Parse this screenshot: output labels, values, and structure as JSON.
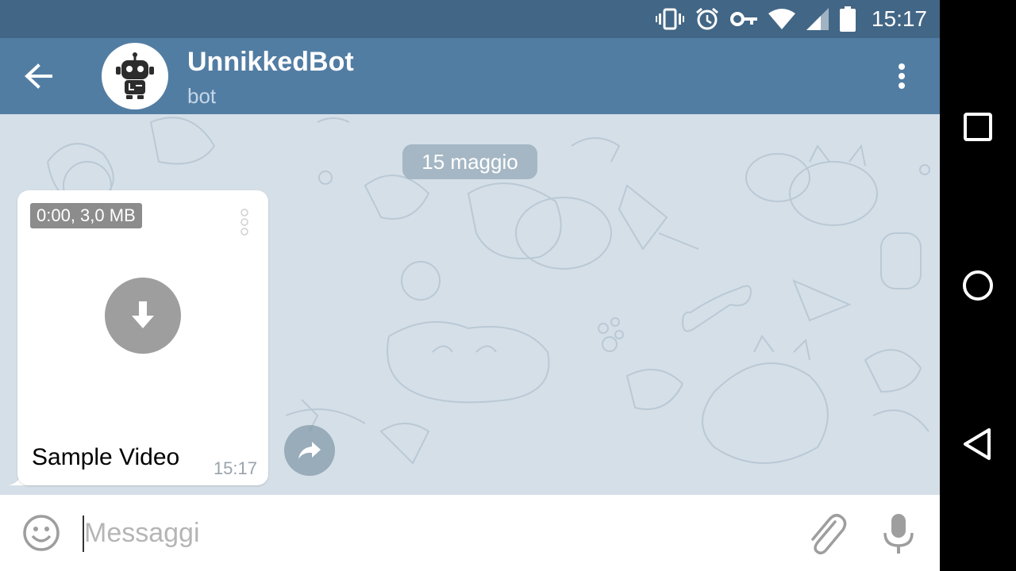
{
  "status_bar": {
    "time": "15:17",
    "icons": [
      "vibrate-icon",
      "alarm-icon",
      "vpn-key-icon",
      "wifi-icon",
      "cell-signal-icon",
      "battery-icon"
    ]
  },
  "header": {
    "title": "UnnikkedBot",
    "subtitle": "bot",
    "back_icon": "arrow-back-icon",
    "menu_icon": "more-vert-icon",
    "colors": {
      "status_bar": "#426685",
      "header": "#527da3"
    }
  },
  "chat": {
    "date_chip": "15 maggio",
    "message": {
      "video_info": "0:00, 3,0 MB",
      "caption": "Sample Video",
      "time": "15:17",
      "download_icon": "download-arrow-icon",
      "share_icon": "share-icon"
    },
    "colors": {
      "wallpaper": "#d5dfe8",
      "bubble": "#ffffff"
    }
  },
  "input": {
    "placeholder": "Messaggi",
    "emoji_icon": "emoji-icon",
    "attach_icon": "paperclip-icon",
    "mic_icon": "microphone-icon"
  },
  "nav": {
    "icons": [
      "recents-square-icon",
      "home-circle-icon",
      "back-triangle-icon"
    ]
  }
}
